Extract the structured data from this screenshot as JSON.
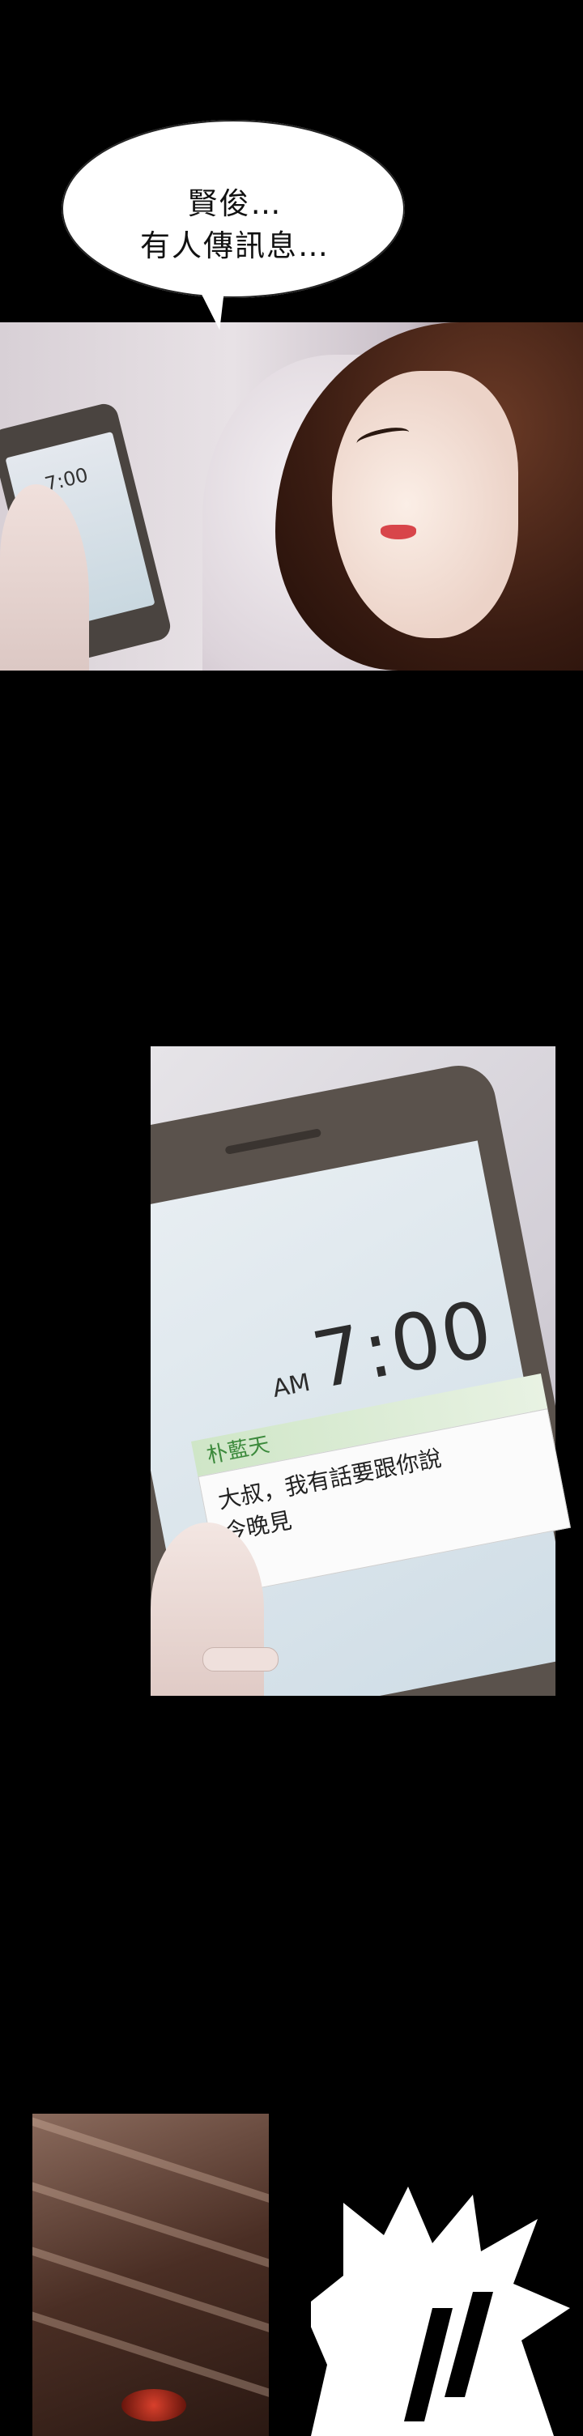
{
  "speech_bubble": {
    "line1": "賢俊…",
    "line2": "有人傳訊息…"
  },
  "panel1": {
    "phone_time": "7:00"
  },
  "panel2": {
    "am_label": "AM",
    "clock": "7:00",
    "notification": {
      "sender": "朴藍天",
      "line1": "大叔，我有話要跟你說",
      "line2": "今晚見"
    }
  },
  "colors": {
    "background": "#000000",
    "notification_header": "#cfe6c7",
    "notification_sender": "#3c8a3c",
    "lips": "#d8454a"
  }
}
